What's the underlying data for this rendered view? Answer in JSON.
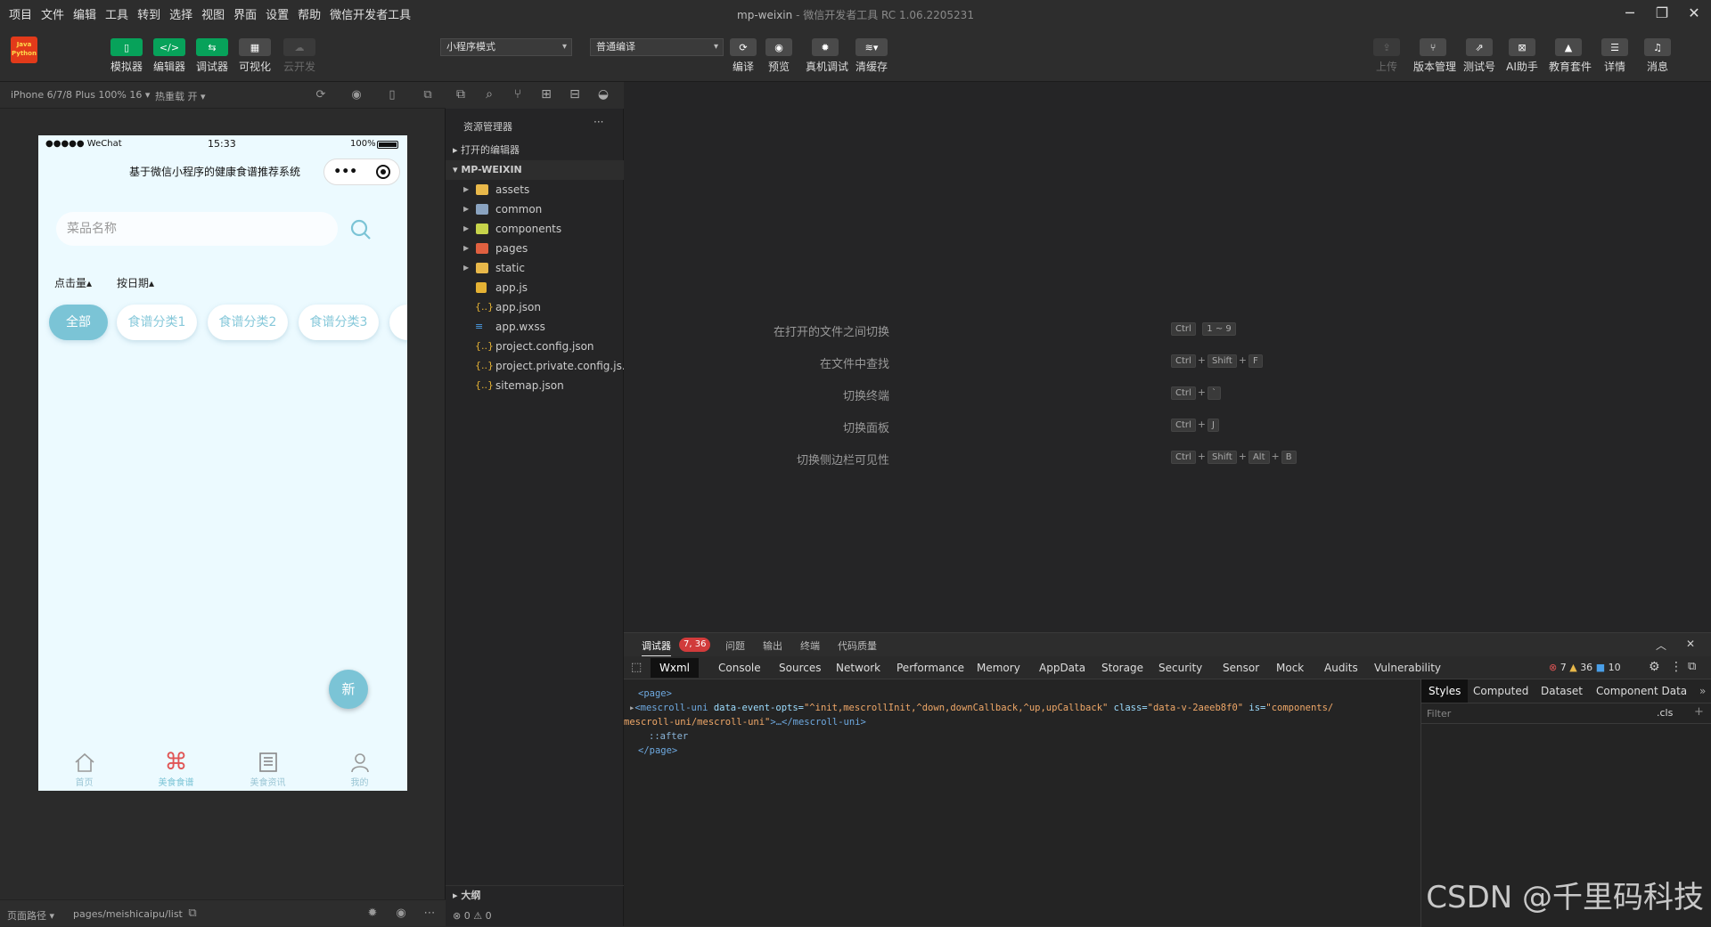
{
  "menubar": {
    "items": [
      "项目",
      "文件",
      "编辑",
      "工具",
      "转到",
      "选择",
      "视图",
      "界面",
      "设置",
      "帮助",
      "微信开发者工具"
    ],
    "window_title": "mp-weixin",
    "window_subtitle": "- 微信开发者工具 RC 1.06.2205231"
  },
  "toolbar": {
    "logo_text": "Java Python",
    "left_buttons": [
      "模拟器",
      "编辑器",
      "调试器",
      "可视化",
      "云开发"
    ],
    "mode_select": "小程序模式",
    "compile_select": "普通编译",
    "center_buttons": [
      "编译",
      "预览",
      "真机调试",
      "清缓存"
    ],
    "right_buttons": [
      "上传",
      "版本管理",
      "测试号",
      "AI助手",
      "教育套件",
      "详情",
      "消息"
    ]
  },
  "simulator": {
    "device": "iPhone 6/7/8 Plus 100% 16 ▾",
    "hotreload": "热重载 开 ▾",
    "status": {
      "carrier": "●●●●● WeChat",
      "time": "15:33",
      "battery": "100%"
    },
    "nav_title": "基于微信小程序的健康食谱推荐系统",
    "capsule_dots": "•••",
    "search_placeholder": "菜品名称",
    "sort": [
      "点击量▴",
      "按日期▴"
    ],
    "chips": [
      "全部",
      "食谱分类1",
      "食谱分类2",
      "食谱分类3"
    ],
    "new_button": "新",
    "tabs": [
      "首页",
      "美食食谱",
      "美食资讯",
      "我的"
    ],
    "footer_path_label": "页面路径 ▾",
    "footer_path": "pages/meishicaipu/list"
  },
  "explorer": {
    "title": "资源管理器",
    "more": "···",
    "open_editors": "打开的编辑器",
    "project": "MP-WEIXIN",
    "folders": [
      "assets",
      "common",
      "components",
      "pages",
      "static"
    ],
    "files": [
      "app.js",
      "app.json",
      "app.wxss",
      "project.config.json",
      "project.private.config.js...",
      "sitemap.json"
    ],
    "outline": "大纲",
    "problems": "⊗ 0 ⚠ 0"
  },
  "editor": {
    "hints": [
      {
        "label": "在打开的文件之间切换",
        "keys": [
          "Ctrl",
          "1 ~ 9"
        ]
      },
      {
        "label": "在文件中查找",
        "keys": [
          "Ctrl",
          "+",
          "Shift",
          "+",
          "F"
        ]
      },
      {
        "label": "切换终端",
        "keys": [
          "Ctrl",
          "+",
          "`"
        ]
      },
      {
        "label": "切换面板",
        "keys": [
          "Ctrl",
          "+",
          "J"
        ]
      },
      {
        "label": "切换侧边栏可见性",
        "keys": [
          "Ctrl",
          "+",
          "Shift",
          "+",
          "Alt",
          "+",
          "B"
        ]
      }
    ]
  },
  "debugger": {
    "tabs": [
      "调试器",
      "问题",
      "输出",
      "终端",
      "代码质量"
    ],
    "badge": "7, 36",
    "devtools_tabs": [
      "Wxml",
      "Console",
      "Sources",
      "Network",
      "Performance",
      "Memory",
      "AppData",
      "Storage",
      "Security",
      "Sensor",
      "Mock",
      "Audits",
      "Vulnerability"
    ],
    "counts": {
      "errors": "7",
      "warnings": "36",
      "info": "10"
    },
    "code": {
      "line1": "<page>",
      "line2_tag": "<mescroll-uni",
      "line2_attr1": " data-event-opts=",
      "line2_val1": "\"^init,mescrollInit,^down,downCallback,^up,upCallback\"",
      "line2_attr2": " class=",
      "line2_val2": "\"data-v-2aeeb8f0\"",
      "line2_attr3": " is=",
      "line2_val3": "\"components/",
      "line3_val": "mescroll-uni/mescroll-uni\"",
      "line3_tag": ">…</mescroll-uni>",
      "line4": "::after",
      "line5": "</page>"
    },
    "styles_tabs": [
      "Styles",
      "Computed",
      "Dataset",
      "Component Data"
    ],
    "filter_placeholder": "Filter",
    "cls": ".cls",
    "plus": "+"
  },
  "watermark": "CSDN @千里码科技"
}
